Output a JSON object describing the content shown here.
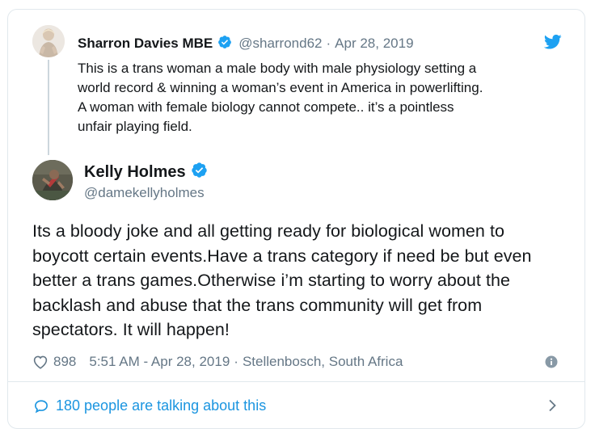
{
  "colors": {
    "brand_blue": "#1da1f2",
    "link_blue": "#1b95e0",
    "text_primary": "#14171a",
    "text_secondary": "#657786",
    "border": "#e1e8ed"
  },
  "parent_tweet": {
    "display_name": "Sharron Davies MBE",
    "verified": true,
    "handle": "@sharrond62",
    "separator": "·",
    "date": "Apr 28, 2019",
    "lines": [
      "This is a trans woman a male body with male physiology setting a",
      "world record & winning a woman’s event in America in powerlifting.",
      "A woman with female biology cannot compete.. it’s a pointless",
      "unfair playing field."
    ],
    "icons": {
      "avatar": "avatar-photo",
      "brand": "twitter-bird-icon",
      "badge": "verified-badge-icon"
    }
  },
  "main_tweet": {
    "display_name": "Kelly Holmes",
    "verified": true,
    "handle": "@damekellyholmes",
    "lines": [
      "Its a bloody joke and all getting ready for biological women to",
      "boycott certain events.Have a trans category if need be but even",
      "better a trans games.Otherwise i’m starting to worry about the",
      "backlash and abuse that the trans community will get from",
      "spectators. It will happen!"
    ]
  },
  "meta": {
    "like_count": "898",
    "timestamp": "5:51 AM - Apr 28, 2019",
    "separator": "·",
    "location": "Stellenbosch, South Africa",
    "icons": {
      "like": "heart-icon",
      "info": "info-icon"
    }
  },
  "footer": {
    "talking_text": "180 people are talking about this",
    "icons": {
      "reply": "speech-bubble-icon",
      "arrow": "chevron-right-icon"
    }
  }
}
